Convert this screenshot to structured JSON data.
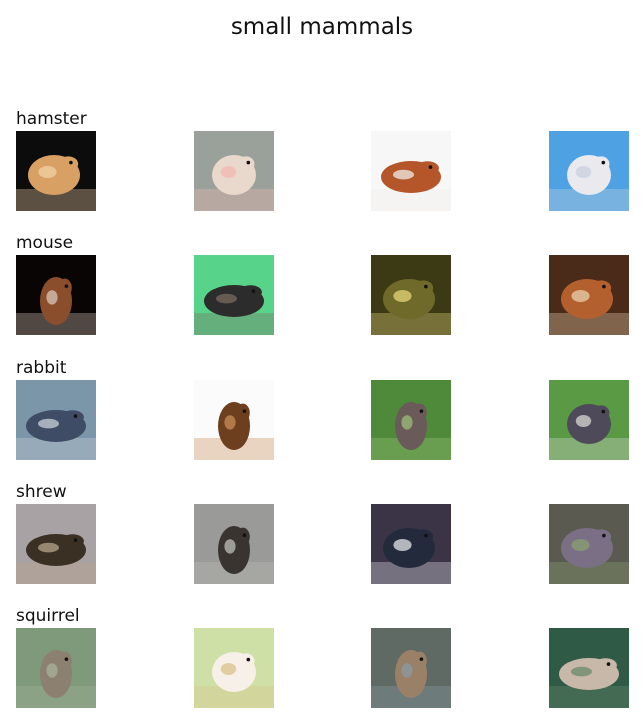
{
  "figure": {
    "title": "small mammals"
  },
  "rows": [
    {
      "label": "hamster",
      "images": [
        {
          "depicts": "hamster-photo",
          "bg": "#0c0c0c",
          "fg": "#d9a064",
          "accent": "#f2d1a6",
          "shape": "blob"
        },
        {
          "depicts": "hamster-photo",
          "bg": "#9aa09a",
          "fg": "#e9d8cc",
          "accent": "#f0b7b2",
          "shape": "round"
        },
        {
          "depicts": "hamster-photo",
          "bg": "#f7f7f7",
          "fg": "#b5552a",
          "accent": "#f0ede8",
          "shape": "wide"
        },
        {
          "depicts": "hamster-photo",
          "bg": "#4ea2e3",
          "fg": "#e9e9ee",
          "accent": "#c7d0de",
          "shape": "round"
        }
      ]
    },
    {
      "label": "mouse",
      "images": [
        {
          "depicts": "mouse-photo",
          "bg": "#0a0505",
          "fg": "#8a4e2c",
          "accent": "#d8c7b8",
          "shape": "tall"
        },
        {
          "depicts": "mouse-photo",
          "bg": "#58d48a",
          "fg": "#2c2c2c",
          "accent": "#7a6b5e",
          "shape": "wide"
        },
        {
          "depicts": "mouse-photo",
          "bg": "#3c3a14",
          "fg": "#6f6a2a",
          "accent": "#e6d67a",
          "shape": "blob"
        },
        {
          "depicts": "mouse-photo",
          "bg": "#4a2a18",
          "fg": "#b4602e",
          "accent": "#e8d0b0",
          "shape": "blob"
        }
      ]
    },
    {
      "label": "rabbit",
      "images": [
        {
          "depicts": "rabbit-photo",
          "bg": "#7c96a9",
          "fg": "#3f4c66",
          "accent": "#c9d1d8",
          "shape": "wide"
        },
        {
          "depicts": "rabbit-photo",
          "bg": "#fbfbfb",
          "fg": "#6e3f1e",
          "accent": "#c98c55",
          "shape": "tall"
        },
        {
          "depicts": "rabbit-photo",
          "bg": "#4f8a3a",
          "fg": "#6a5a5a",
          "accent": "#9bbf7a",
          "shape": "tall"
        },
        {
          "depicts": "rabbit-photo",
          "bg": "#5a9a45",
          "fg": "#4e4a5a",
          "accent": "#d8d8d0",
          "shape": "round"
        }
      ]
    },
    {
      "label": "shrew",
      "images": [
        {
          "depicts": "shrew-photo",
          "bg": "#a9a2a4",
          "fg": "#3a3024",
          "accent": "#b7a48a",
          "shape": "wide"
        },
        {
          "depicts": "shrew-photo",
          "bg": "#9a9a98",
          "fg": "#3a3430",
          "accent": "#bdbdb8",
          "shape": "tall"
        },
        {
          "depicts": "shrew-photo",
          "bg": "#3a3446",
          "fg": "#232a3c",
          "accent": "#e6e6ea",
          "shape": "blob"
        },
        {
          "depicts": "shrew-photo",
          "bg": "#5a5a50",
          "fg": "#7a6f84",
          "accent": "#8aa070",
          "shape": "blob"
        }
      ]
    },
    {
      "label": "squirrel",
      "images": [
        {
          "depicts": "squirrel-photo",
          "bg": "#7f9a7a",
          "fg": "#8c8070",
          "accent": "#a7b39a",
          "shape": "tall"
        },
        {
          "depicts": "squirrel-photo",
          "bg": "#cfe0a6",
          "fg": "#f6f0e8",
          "accent": "#d9c28a",
          "shape": "round"
        },
        {
          "depicts": "squirrel-photo",
          "bg": "#5f6a64",
          "fg": "#9a8066",
          "accent": "#8a9aa6",
          "shape": "tall"
        },
        {
          "depicts": "squirrel-photo",
          "bg": "#2f5a46",
          "fg": "#c8b8aa",
          "accent": "#6a8a6a",
          "shape": "wide"
        }
      ]
    }
  ]
}
